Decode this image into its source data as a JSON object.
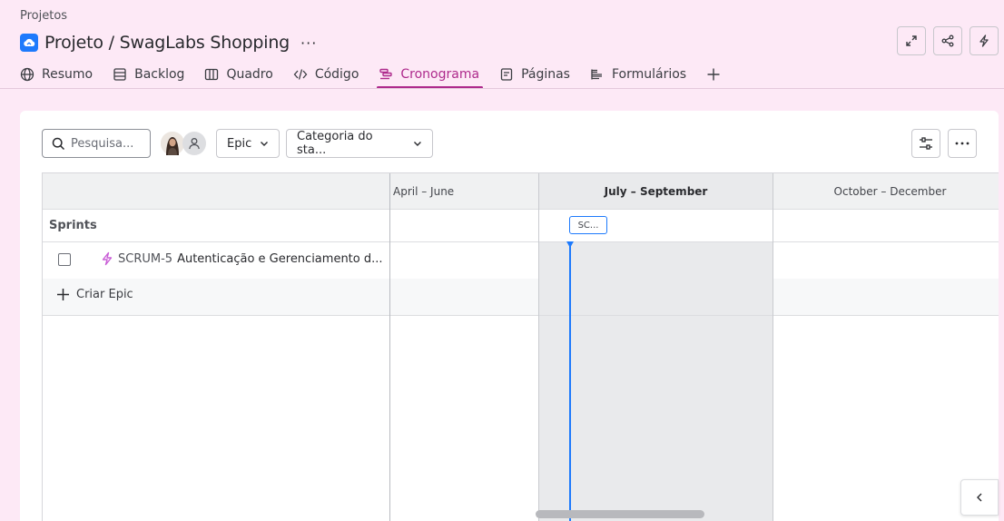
{
  "header": {
    "breadcrumb": "Projetos",
    "title": "Projeto / SwagLabs Shopping",
    "more_label": "···"
  },
  "icons": {
    "project": "cloud-project-icon",
    "expand": "expand-icon",
    "share": "share-icon",
    "automation": "lightning-icon",
    "search": "search-icon",
    "filter": "filter-settings-icon",
    "more": "more-horizontal-icon",
    "epic": "lightning-epic-icon",
    "add": "plus-icon",
    "collapse": "chevron-left-icon"
  },
  "tabs": [
    {
      "label": "Resumo",
      "icon": "globe-icon",
      "active": false
    },
    {
      "label": "Backlog",
      "icon": "backlog-icon",
      "active": false
    },
    {
      "label": "Quadro",
      "icon": "board-icon",
      "active": false
    },
    {
      "label": "Código",
      "icon": "code-icon",
      "active": false
    },
    {
      "label": "Cronograma",
      "icon": "timeline-icon",
      "active": true
    },
    {
      "label": "Páginas",
      "icon": "pages-icon",
      "active": false
    },
    {
      "label": "Formulários",
      "icon": "forms-icon",
      "active": false
    }
  ],
  "toolbar": {
    "search_placeholder": "Pesquisa...",
    "epic_filter": "Epic",
    "status_filter": "Categoria do sta..."
  },
  "timeline": {
    "quarters": [
      "April – June",
      "July – September",
      "October – December"
    ],
    "sprints_label": "Sprints",
    "sprint_chip": "SC...",
    "epics": [
      {
        "key": "SCRUM-5",
        "summary": "Autenticação e Gerenciamento d..."
      }
    ],
    "create_label": "Criar Epic"
  },
  "colors": {
    "background": "#fde9f6",
    "accent": "#ae2a8c",
    "today_line": "#1d7afc",
    "epic_icon": "#c95ed6"
  }
}
